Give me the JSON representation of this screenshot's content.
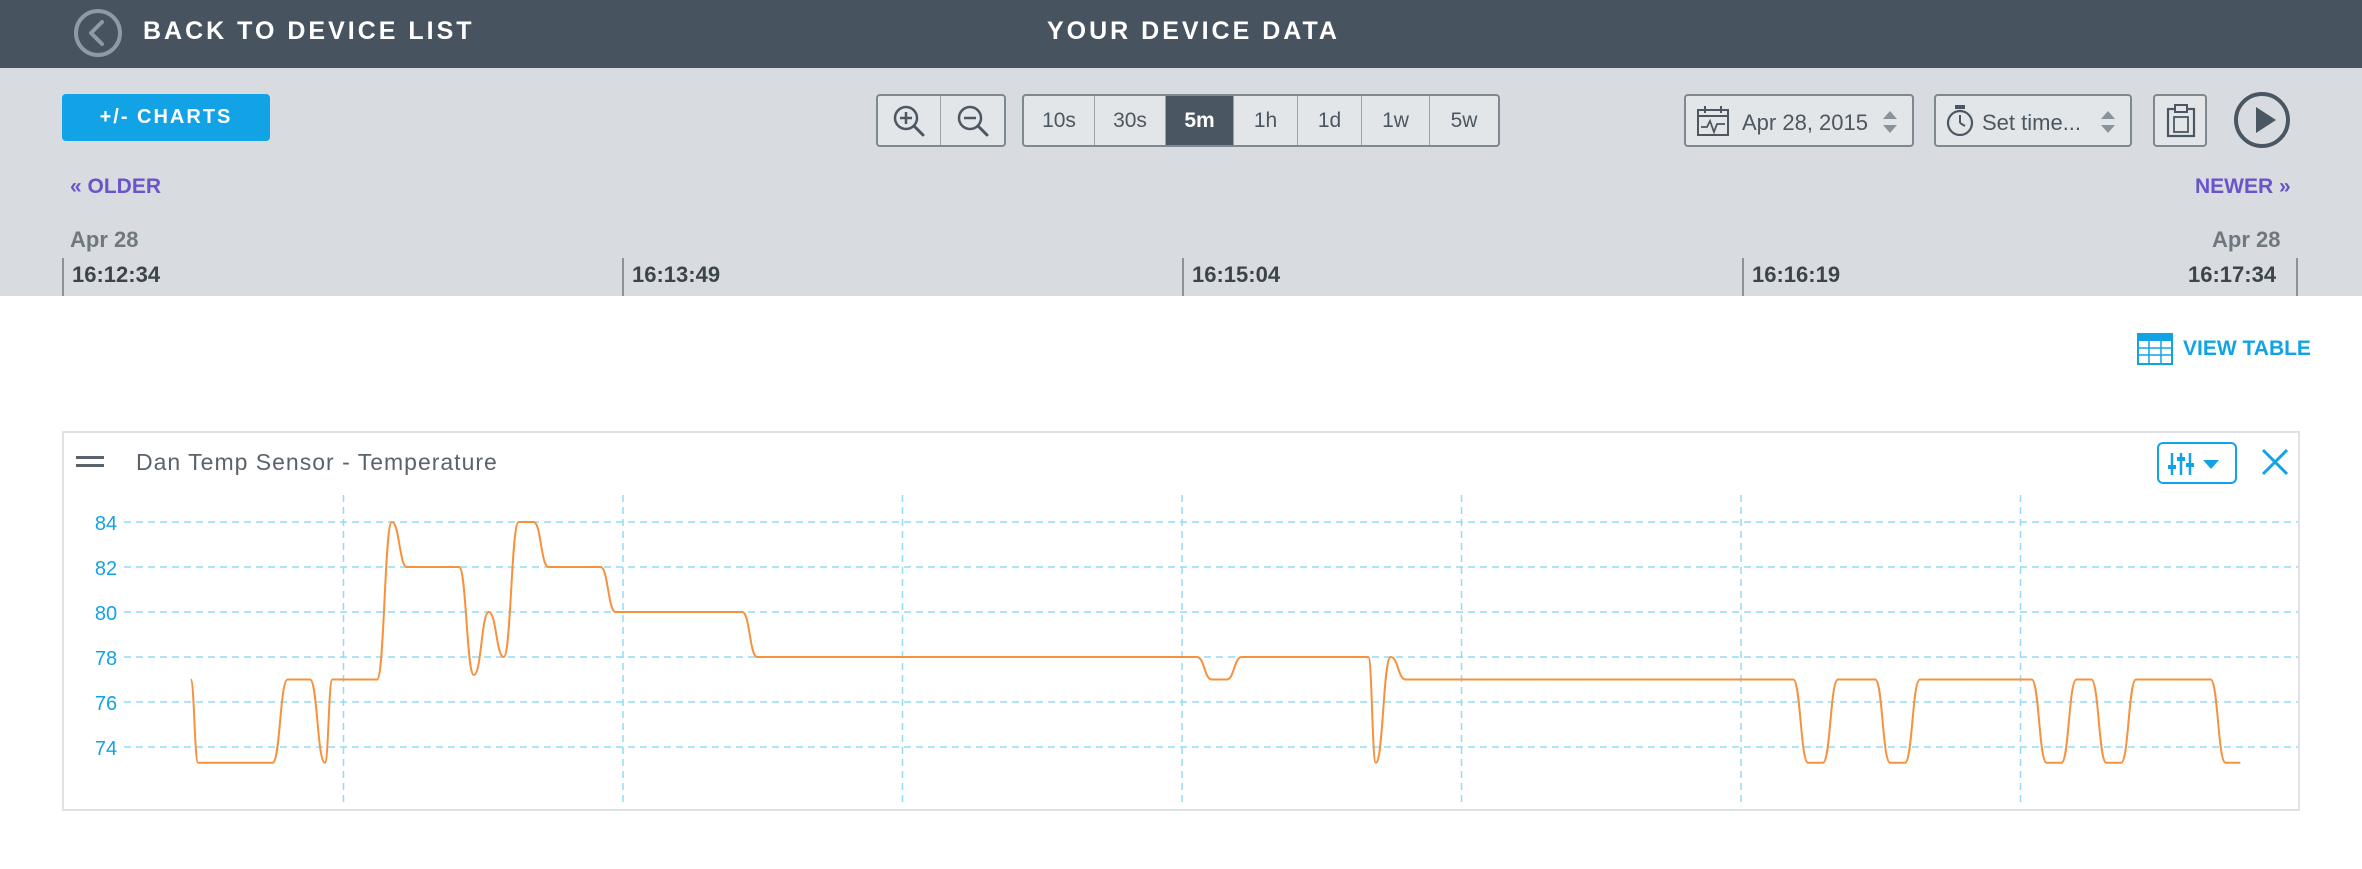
{
  "header": {
    "back_label": "BACK TO DEVICE LIST",
    "title": "YOUR DEVICE DATA"
  },
  "toolbar": {
    "charts_button": "+/- CHARTS",
    "zoom_in_icon": "zoom-in-icon",
    "zoom_out_icon": "zoom-out-icon",
    "ranges": [
      "10s",
      "30s",
      "5m",
      "1h",
      "1d",
      "1w",
      "5w"
    ],
    "active_range": "5m",
    "date_value": "Apr 28, 2015",
    "time_placeholder": "Set time...",
    "clipboard_icon": "clipboard-icon",
    "play_icon": "play-icon"
  },
  "timeline": {
    "older": "« OLDER",
    "newer": "NEWER »",
    "start_date": "Apr 28",
    "end_date": "Apr 28",
    "ticks": [
      "16:12:34",
      "16:13:49",
      "16:15:04",
      "16:16:19",
      "16:17:34"
    ]
  },
  "view_table": "VIEW TABLE",
  "chart_card": {
    "title": "Dan Temp Sensor - Temperature",
    "accent": "#12a3e6",
    "line_color": "#f7913d"
  },
  "chart_data": {
    "type": "line",
    "title": "Dan Temp Sensor - Temperature",
    "xlabel": "",
    "ylabel": "",
    "xlim": [
      "16:12:34",
      "16:17:34"
    ],
    "ylim": [
      73,
      85
    ],
    "yticks": [
      74,
      76,
      78,
      80,
      82,
      84
    ],
    "grid": true,
    "series": [
      {
        "points": [
          [
            "16:12:51",
            77
          ],
          [
            "16:12:52",
            73.3
          ],
          [
            "16:13:02",
            73.3
          ],
          [
            "16:13:04",
            77
          ],
          [
            "16:13:07",
            77
          ],
          [
            "16:13:09",
            73.3
          ],
          [
            "16:13:10",
            77
          ],
          [
            "16:13:16",
            77
          ],
          [
            "16:13:18",
            84
          ],
          [
            "16:13:20",
            82
          ],
          [
            "16:13:27",
            82
          ],
          [
            "16:13:29",
            77.2
          ],
          [
            "16:13:31",
            80
          ],
          [
            "16:13:33",
            78
          ],
          [
            "16:13:35",
            84
          ],
          [
            "16:13:37",
            84
          ],
          [
            "16:13:39",
            82
          ],
          [
            "16:13:46",
            82
          ],
          [
            "16:13:48",
            80
          ],
          [
            "16:14:05",
            80
          ],
          [
            "16:14:07",
            78
          ],
          [
            "16:15:06",
            78
          ],
          [
            "16:15:08",
            77
          ],
          [
            "16:15:10",
            77
          ],
          [
            "16:15:12",
            78
          ],
          [
            "16:15:29",
            78
          ],
          [
            "16:15:30",
            73.3
          ],
          [
            "16:15:32",
            78
          ],
          [
            "16:15:34",
            77
          ],
          [
            "16:16:26",
            77
          ],
          [
            "16:16:28",
            73.3
          ],
          [
            "16:16:30",
            73.3
          ],
          [
            "16:16:32",
            77
          ],
          [
            "16:16:37",
            77
          ],
          [
            "16:16:39",
            73.3
          ],
          [
            "16:16:41",
            73.3
          ],
          [
            "16:16:43",
            77
          ],
          [
            "16:16:58",
            77
          ],
          [
            "16:17:00",
            73.3
          ],
          [
            "16:17:02",
            73.3
          ],
          [
            "16:17:04",
            77
          ],
          [
            "16:17:06",
            77
          ],
          [
            "16:17:08",
            73.3
          ],
          [
            "16:17:10",
            73.3
          ],
          [
            "16:17:12",
            77
          ],
          [
            "16:17:22",
            77
          ],
          [
            "16:17:24",
            73.3
          ],
          [
            "16:17:26",
            73.3
          ]
        ]
      }
    ]
  }
}
